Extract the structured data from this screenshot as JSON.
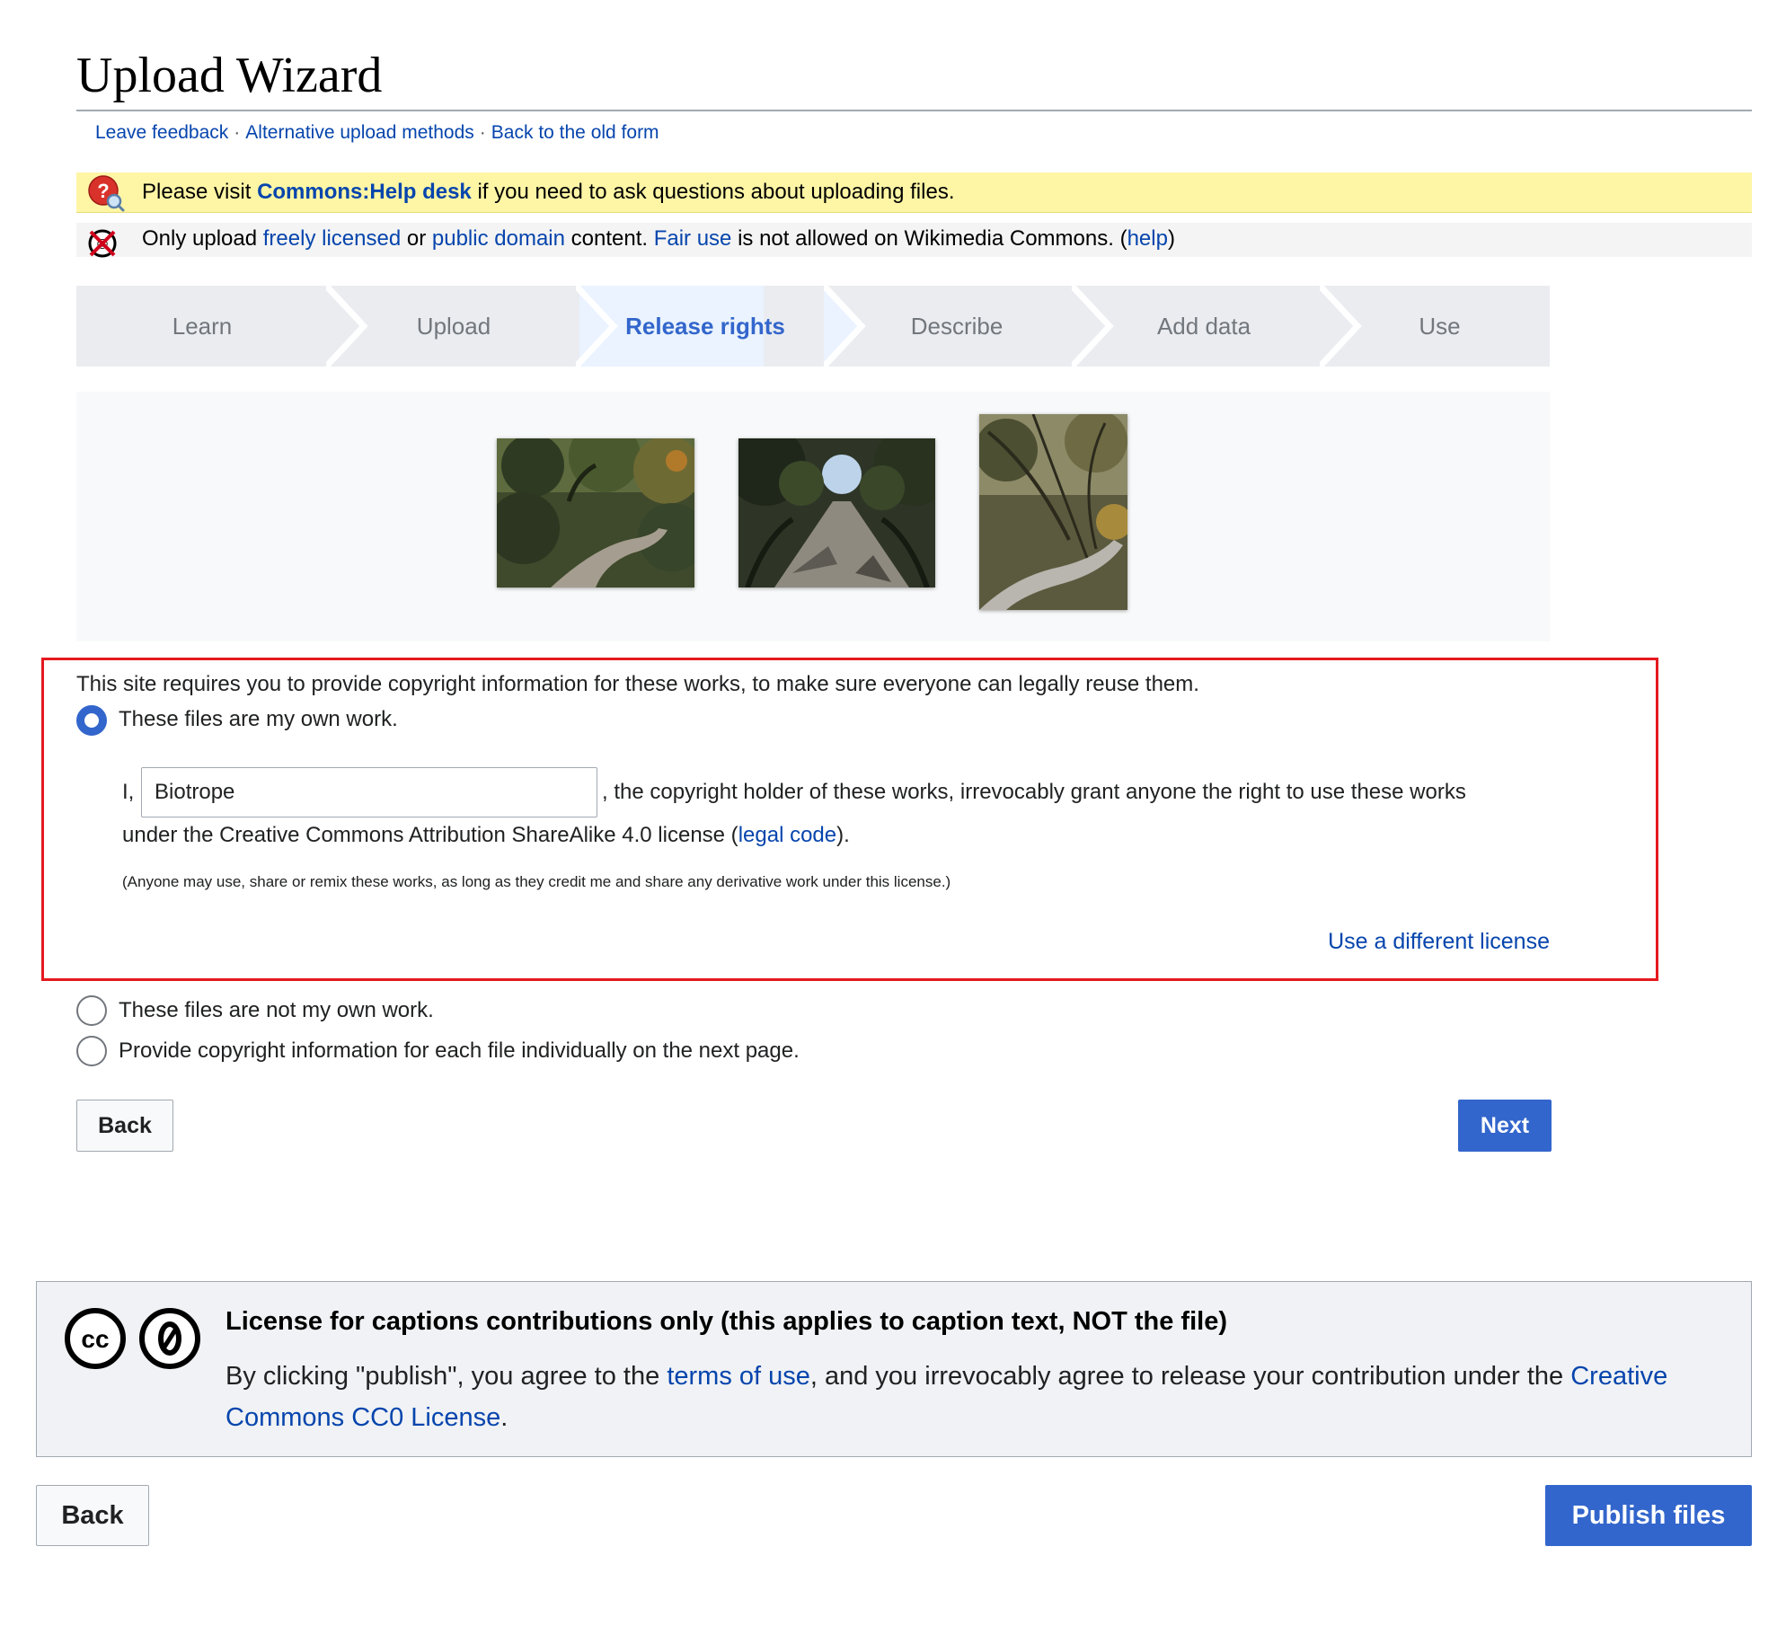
{
  "header": {
    "title": "Upload Wizard",
    "links": [
      "Leave feedback",
      "Alternative upload methods",
      "Back to the old form"
    ],
    "separator": "·"
  },
  "notices": {
    "help": {
      "icon": "help-desk-icon",
      "prefix": "Please visit ",
      "link": "Commons:Help desk",
      "suffix": " if you need to ask questions about uploading files."
    },
    "license": {
      "icon": "no-fair-use-icon",
      "t1": "Only upload ",
      "l1": "freely licensed",
      "t2": " or ",
      "l2": "public domain",
      "t3": " content. ",
      "l3": "Fair use",
      "t4": " is not allowed on Wikimedia Commons. (",
      "l4": "help",
      "t5": ")"
    }
  },
  "steps": {
    "items": [
      "Learn",
      "Upload",
      "Release rights",
      "Describe",
      "Add data",
      "Use"
    ],
    "active": "Release rights"
  },
  "thumbnails": {
    "count": 3,
    "icon": "trail-photo-thumbnail"
  },
  "release": {
    "intro": "This site requires you to provide copyright information for these works, to make sure everyone can legally reuse them.",
    "options": [
      {
        "label": "These files are my own work.",
        "checked": true
      },
      {
        "label": "These files are not my own work.",
        "checked": false
      },
      {
        "label": "Provide copyright information for each file individually on the next page.",
        "checked": false
      }
    ],
    "own_work": {
      "prefix": "I,",
      "name_value": "Biotrope",
      "after_input": ", the copyright holder of these works, irrevocably grant anyone the right to use these works",
      "line2_prefix": "under the Creative Commons Attribution ShareAlike 4.0 license (",
      "legal_code": "legal code",
      "line2_suffix": ").",
      "note": "(Anyone may use, share or remix these works, as long as they credit me and share any derivative work under this license.)",
      "different_license": "Use a different license"
    },
    "back_label": "Back",
    "next_label": "Next"
  },
  "caption_license": {
    "icons": [
      "cc-icon",
      "zero-icon"
    ],
    "title": "License for captions contributions only (this applies to caption text, NOT the file)",
    "t1": "By clicking \"publish\", you agree to the ",
    "terms": "terms of use",
    "t2": ", and you irrevocably agree to release your contribution under the ",
    "cc0": "Creative Commons CC0 License",
    "t3": "."
  },
  "footer": {
    "back_label": "Back",
    "publish_label": "Publish files"
  },
  "colors": {
    "link": "#0645ad",
    "primary": "#3366cc",
    "highlight": "#e5191f",
    "notice_yellow": "#fef6a5"
  }
}
